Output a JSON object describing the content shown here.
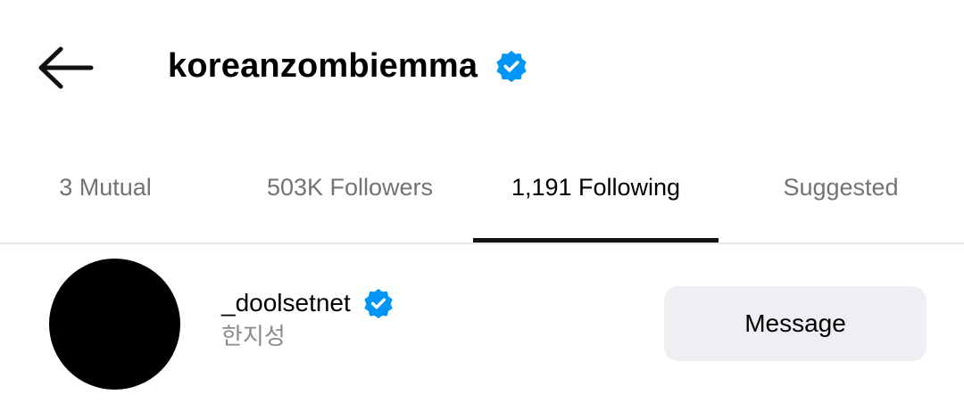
{
  "header": {
    "title": "koreanzombiemma",
    "verified": true,
    "back_icon": "arrow-left-icon"
  },
  "tabs": [
    {
      "label": "3 Mutual",
      "active": false
    },
    {
      "label": "503K Followers",
      "active": false
    },
    {
      "label": "1,191 Following",
      "active": true
    },
    {
      "label": "Suggested",
      "active": false
    }
  ],
  "list": [
    {
      "username": "_doolsetnet",
      "fullname": "한지성",
      "verified": true,
      "action_label": "Message"
    }
  ],
  "colors": {
    "verified_badge": "#0095f6",
    "tab_inactive": "#737373",
    "tab_active": "#000000",
    "button_bg": "#efeff3",
    "secondary_text": "#8a8a8a"
  }
}
